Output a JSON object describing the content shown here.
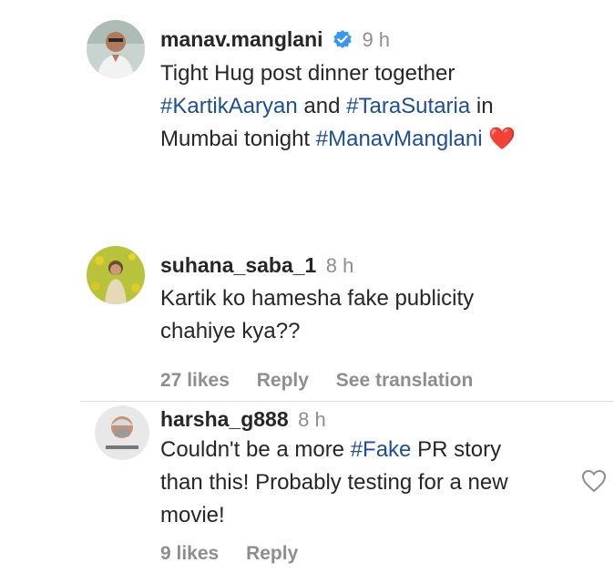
{
  "comments": [
    {
      "username": "manav.manglani",
      "time": "9 h",
      "verified": true,
      "lines": [
        [
          {
            "t": "Tight Hug post dinner together"
          }
        ],
        [
          {
            "t": "#KartikAaryan",
            "tag": true
          },
          {
            "t": " and "
          },
          {
            "t": "#TaraSutaria",
            "tag": true
          },
          {
            "t": " in"
          }
        ],
        [
          {
            "t": "Mumbai tonight "
          },
          {
            "t": "#ManavManglani",
            "tag": true
          },
          {
            "t": " ❤️"
          }
        ]
      ]
    },
    {
      "username": "suhana_saba_1",
      "time": "8 h",
      "lines": [
        [
          {
            "t": "Kartik ko hamesha fake publicity"
          }
        ],
        [
          {
            "t": "chahiye kya??"
          }
        ]
      ],
      "likes": "27 likes",
      "reply": "Reply",
      "translate": "See translation"
    },
    {
      "username": "harsha_g888",
      "time": "8 h",
      "lines": [
        [
          {
            "t": "Couldn't be a more "
          },
          {
            "t": "#Fake",
            "tag": true
          },
          {
            "t": " PR story"
          }
        ],
        [
          {
            "t": "than this! Probably testing for a new"
          }
        ],
        [
          {
            "t": "movie!"
          }
        ]
      ],
      "likes": "9 likes",
      "reply": "Reply"
    }
  ],
  "colors": {
    "hashtag": "#1f4f8f",
    "verified": "#3897f0",
    "muted": "#8e8e8e"
  },
  "icons": {
    "verified": "verified-badge-icon",
    "like": "heart-outline-icon"
  }
}
